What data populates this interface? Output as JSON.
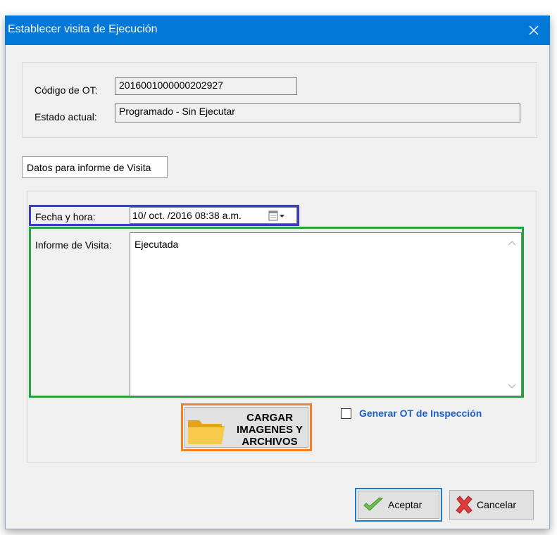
{
  "window": {
    "title": "Establecer visita de Ejecución"
  },
  "header_group": {
    "ot_code_label": "Código de OT:",
    "ot_code_value": "2016001000000202927",
    "status_label": "Estado actual:",
    "status_value": "Programado - Sin Ejecutar"
  },
  "tab": {
    "label": "Datos para informe de Visita"
  },
  "visit": {
    "date_label": "Fecha y hora:",
    "date_value": "10/ oct. /2016 08:38 a.m.",
    "report_label": "Informe de Visita:",
    "report_value": "Ejecutada"
  },
  "upload_button": {
    "line1": "CARGAR",
    "line2": "IMAGENES Y",
    "line3": "ARCHIVOS"
  },
  "inspection_checkbox": {
    "label": "Generar OT de Inspección",
    "checked": false
  },
  "buttons": {
    "accept": "Aceptar",
    "cancel": "Cancelar"
  },
  "colors": {
    "titlebar": "#0078d7",
    "highlight_date": "#3b3bc9",
    "highlight_report": "#22a43c",
    "highlight_upload": "#f28228",
    "highlight_accept": "#1f78c8",
    "checkbox_label": "#1c5fc4"
  },
  "icons": {
    "close": "close-icon",
    "calendar": "calendar-dropdown-icon",
    "folder": "folder-icon",
    "accept": "green-check-icon",
    "cancel": "red-x-icon"
  }
}
